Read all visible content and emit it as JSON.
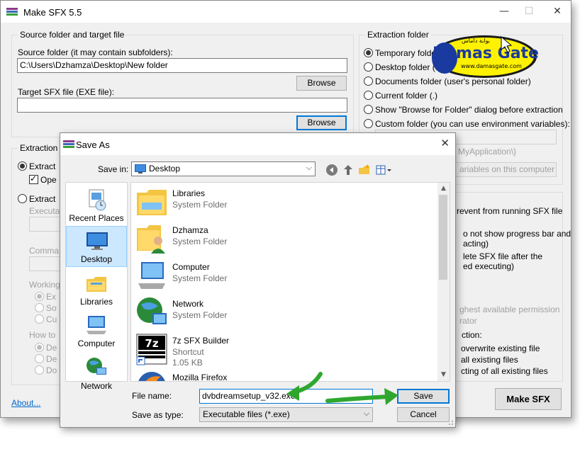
{
  "main": {
    "title": "Make SFX 5.5",
    "source_group": {
      "title": "Source folder and target file",
      "source_label": "Source folder (it may contain subfolders):",
      "source_value": "C:\\Users\\Dzhamza\\Desktop\\New folder",
      "target_label": "Target SFX file (EXE file):",
      "target_value": "",
      "browse_label": "Browse"
    },
    "extraction_folder": {
      "title": "Extraction folder",
      "options": [
        "Temporary folder",
        "Desktop folder (user's",
        "Documents folder (user's personal folder)",
        "Current folder (.)",
        "Show \"Browse for Folder\" dialog before extraction",
        "Custom folder (you can use environment variables):"
      ],
      "custom_example": "MyApplication\\}",
      "variables_button": "ariables on this computer"
    },
    "extraction_group": {
      "title": "Extraction",
      "extract_label": "Extract",
      "open_label": "Ope",
      "extract2_label": "Extract",
      "executable_label": "Executa",
      "command_label": "Comma",
      "working_label": "Working",
      "working_options": [
        "Ex",
        "So",
        "Cu"
      ],
      "how_label": "How to",
      "how_options": [
        "De",
        "De",
        "Do"
      ]
    },
    "options_group": {
      "prevent_running": [
        "revent from running SFX file",
        ""
      ],
      "no_progress": [
        "o not show progress bar and",
        "acting)"
      ],
      "delete_sfx": [
        "lete SFX file after the",
        "ed executing)"
      ],
      "permission": [
        "ghest available permission",
        "rator"
      ],
      "action_label": "ction:",
      "overwrite_options": [
        "overwrite existing file",
        "all existing files",
        "cting of all existing files"
      ]
    },
    "about_link": "About...",
    "make_sfx_button": "Make SFX"
  },
  "dialog": {
    "title": "Save As",
    "save_in_label": "Save in:",
    "save_in_value": "Desktop",
    "places": [
      {
        "name": "Recent Places"
      },
      {
        "name": "Desktop"
      },
      {
        "name": "Libraries"
      },
      {
        "name": "Computer"
      },
      {
        "name": "Network"
      }
    ],
    "files": [
      {
        "name": "Libraries",
        "type": "System Folder",
        "size": ""
      },
      {
        "name": "Dzhamza",
        "type": "System Folder",
        "size": ""
      },
      {
        "name": "Computer",
        "type": "System Folder",
        "size": ""
      },
      {
        "name": "Network",
        "type": "System Folder",
        "size": ""
      },
      {
        "name": "7z SFX Builder",
        "type": "Shortcut",
        "size": "1.05 KB"
      },
      {
        "name": "Mozilla Firefox",
        "type": "",
        "size": ""
      }
    ],
    "file_name_label": "File name:",
    "file_name_value": "dvbdreamsetup_v32.exe",
    "save_type_label": "Save as type:",
    "save_type_value": "Executable files (*.exe)",
    "save_button": "Save",
    "cancel_button": "Cancel"
  },
  "logo": {
    "text": "Damas Gate",
    "url": "www.damasgate.com",
    "arabic": "بوابة داماس"
  },
  "colors": {
    "accent": "#0078d7",
    "arrow": "#2fa72f",
    "logo_yellow": "#fff200",
    "logo_blue": "#1a3aa0"
  }
}
